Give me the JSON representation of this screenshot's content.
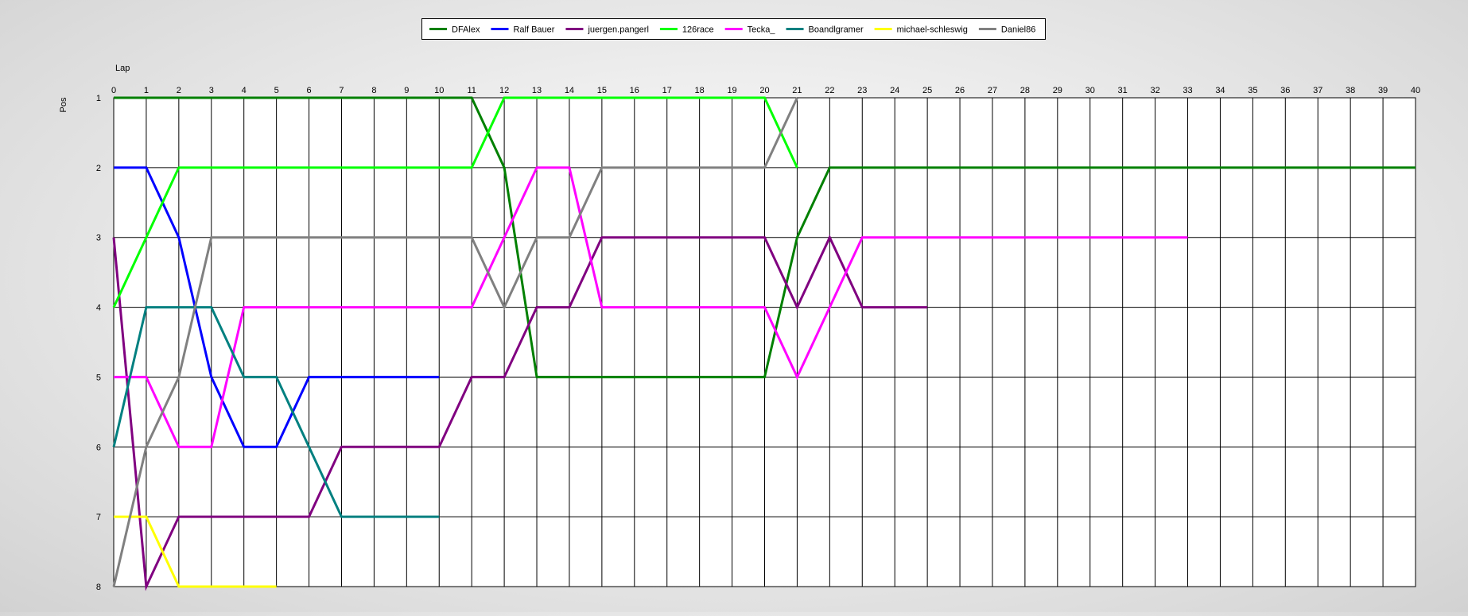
{
  "chart_data": {
    "type": "line",
    "title": "",
    "xlabel": "Lap",
    "ylabel": "Pos",
    "xlim": [
      0,
      40
    ],
    "ylim": [
      1,
      8
    ],
    "y_inverted": true,
    "grid": true,
    "legend_position": "top-center",
    "x_ticks": [
      "0",
      "1",
      "2",
      "3",
      "4",
      "5",
      "6",
      "7",
      "8",
      "9",
      "10",
      "11",
      "12",
      "13",
      "14",
      "15",
      "16",
      "17",
      "18",
      "19",
      "20",
      "21",
      "22",
      "23",
      "24",
      "25",
      "26",
      "27",
      "28",
      "29",
      "30",
      "31",
      "32",
      "33",
      "34",
      "35",
      "36",
      "37",
      "38",
      "39",
      "40"
    ],
    "y_ticks": [
      "1",
      "2",
      "3",
      "4",
      "5",
      "6",
      "7",
      "8"
    ],
    "series": [
      {
        "name": "DFAlex",
        "color": "#008000",
        "values": [
          1,
          1,
          1,
          1,
          1,
          1,
          1,
          1,
          1,
          1,
          1,
          1,
          2,
          5,
          5,
          5,
          5,
          5,
          5,
          5,
          5,
          3,
          2,
          2,
          2,
          2,
          2,
          2,
          2,
          2,
          2,
          2,
          2,
          2,
          2,
          2,
          2,
          2,
          2,
          2,
          2
        ]
      },
      {
        "name": "Ralf Bauer",
        "color": "#0000ff",
        "values": [
          2,
          2,
          3,
          5,
          6,
          6,
          5,
          5,
          5,
          5,
          5
        ]
      },
      {
        "name": "juergen.pangerl",
        "color": "#800080",
        "values": [
          3,
          8,
          7,
          7,
          7,
          7,
          7,
          6,
          6,
          6,
          6,
          5,
          5,
          4,
          4,
          3,
          3,
          3,
          3,
          3,
          3,
          4,
          3,
          4,
          4,
          4
        ]
      },
      {
        "name": "126race",
        "color": "#00ff00",
        "values": [
          4,
          3,
          2,
          2,
          2,
          2,
          2,
          2,
          2,
          2,
          2,
          2,
          1,
          1,
          1,
          1,
          1,
          1,
          1,
          1,
          1,
          2
        ]
      },
      {
        "name": "Tecka_",
        "color": "#ff00ff",
        "values": [
          5,
          5,
          6,
          6,
          4,
          4,
          4,
          4,
          4,
          4,
          4,
          4,
          3,
          2,
          2,
          4,
          4,
          4,
          4,
          4,
          4,
          5,
          4,
          3,
          3,
          3,
          3,
          3,
          3,
          3,
          3,
          3,
          3,
          3
        ]
      },
      {
        "name": "Boandlgramer",
        "color": "#008080",
        "values": [
          6,
          4,
          4,
          4,
          5,
          5,
          6,
          7,
          7,
          7,
          7
        ]
      },
      {
        "name": "michael-schleswig",
        "color": "#ffff00",
        "values": [
          7,
          7,
          8,
          8,
          8,
          8
        ]
      },
      {
        "name": "Daniel86",
        "color": "#808080",
        "values": [
          8,
          6,
          5,
          3,
          3,
          3,
          3,
          3,
          3,
          3,
          3,
          3,
          4,
          3,
          3,
          2,
          2,
          2,
          2,
          2,
          2,
          1
        ]
      }
    ]
  }
}
